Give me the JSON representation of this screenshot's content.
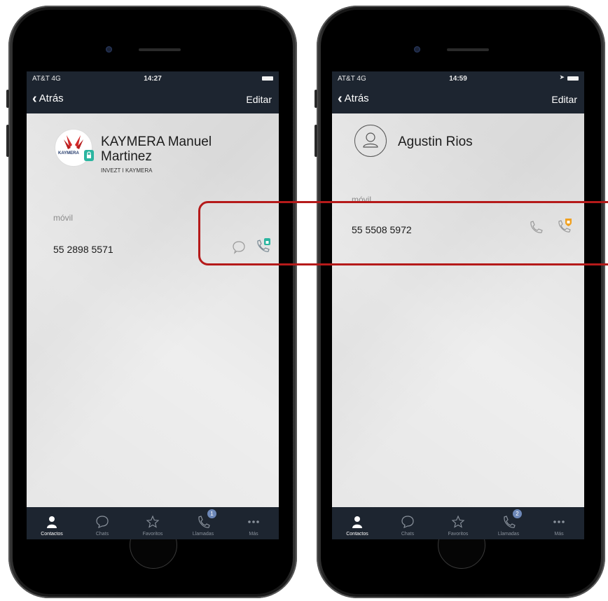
{
  "left_phone": {
    "status": {
      "carrier": "AT&T 4G",
      "time": "14:27"
    },
    "nav": {
      "back_label": "Atrás",
      "edit_label": "Editar"
    },
    "contact": {
      "name_line1": "KAYMERA Manuel",
      "name_line2": "Martinez",
      "company": "INVEZT I KAYMERA",
      "avatar_text": "KAYMERA"
    },
    "phone_label": "móvil",
    "phone_number": "55 2898 5571",
    "tabs": [
      {
        "label": "Contactos",
        "icon": "person-icon"
      },
      {
        "label": "Chats",
        "icon": "chat-bubble-icon"
      },
      {
        "label": "Favoritos",
        "icon": "star-icon"
      },
      {
        "label": "Llamadas",
        "icon": "phone-icon",
        "badge": "1"
      },
      {
        "label": "Más",
        "icon": "more-icon"
      }
    ]
  },
  "right_phone": {
    "status": {
      "carrier": "AT&T 4G",
      "time": "14:59"
    },
    "nav": {
      "back_label": "Atrás",
      "edit_label": "Editar"
    },
    "contact": {
      "name": "Agustin Rios"
    },
    "phone_label": "móvil",
    "phone_number": "55 5508 5972",
    "tabs": [
      {
        "label": "Contactos",
        "icon": "person-icon"
      },
      {
        "label": "Chats",
        "icon": "chat-bubble-icon"
      },
      {
        "label": "Favoritos",
        "icon": "star-icon"
      },
      {
        "label": "Llamadas",
        "icon": "phone-icon",
        "badge": "2"
      },
      {
        "label": "Más",
        "icon": "more-icon"
      }
    ]
  },
  "colors": {
    "bar": "#1d2530",
    "highlight": "#b51a1a",
    "secure_green": "#2bb5a0",
    "secure_orange": "#f0a020"
  }
}
